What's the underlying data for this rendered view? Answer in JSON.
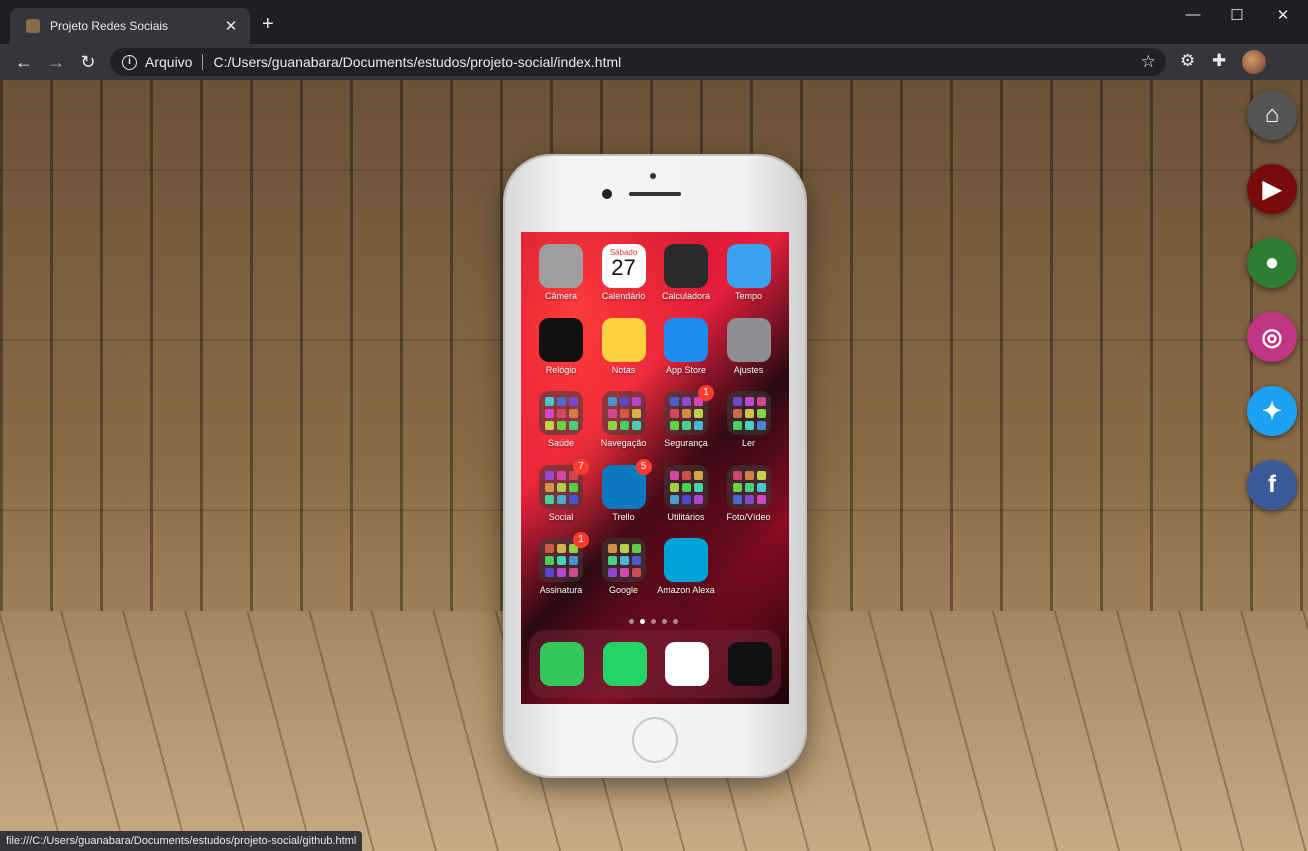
{
  "browser": {
    "tab_title": "Projeto Redes Sociais",
    "tab_close": "✕",
    "new_tab": "+",
    "scheme_label": "Arquivo",
    "url": "C:/Users/guanabara/Documents/estudos/projeto-social/index.html",
    "status_url": "file:///C:/Users/guanabara/Documents/estudos/projeto-social/github.html"
  },
  "phone": {
    "apps": [
      {
        "label": "Câmera",
        "icon": "camera-icon",
        "color": "#9e9e9e"
      },
      {
        "label": "Calendário",
        "icon": "calendar-icon",
        "color": "#ffffff",
        "day_name": "Sábado",
        "day_number": "27"
      },
      {
        "label": "Calculadora",
        "icon": "calculator-icon",
        "color": "#2b2b2b"
      },
      {
        "label": "Tempo",
        "icon": "weather-icon",
        "color": "#3aa0f0"
      },
      {
        "label": "Relógio",
        "icon": "clock-icon",
        "color": "#111111"
      },
      {
        "label": "Notas",
        "icon": "notes-icon",
        "color": "#ffd23f"
      },
      {
        "label": "App Store",
        "icon": "appstore-icon",
        "color": "#1e8cf0"
      },
      {
        "label": "Ajustes",
        "icon": "settings-icon",
        "color": "#8e8e93"
      },
      {
        "label": "Saúde",
        "icon": "folder-icon",
        "color": "#3c3c3c"
      },
      {
        "label": "Navegação",
        "icon": "folder-icon",
        "color": "#3c3c3c"
      },
      {
        "label": "Segurança",
        "icon": "folder-icon",
        "color": "#3c3c3c",
        "badge": "1"
      },
      {
        "label": "Ler",
        "icon": "folder-icon",
        "color": "#3c3c3c"
      },
      {
        "label": "Social",
        "icon": "folder-icon",
        "color": "#3c3c3c",
        "badge": "7"
      },
      {
        "label": "Trello",
        "icon": "trello-icon",
        "color": "#0a79bf",
        "badge": "5"
      },
      {
        "label": "Utilitários",
        "icon": "folder-icon",
        "color": "#3c3c3c"
      },
      {
        "label": "Foto/Vídeo",
        "icon": "folder-icon",
        "color": "#3c3c3c"
      },
      {
        "label": "Assinatura",
        "icon": "folder-icon",
        "color": "#3c3c3c",
        "badge": "1"
      },
      {
        "label": "Google",
        "icon": "folder-icon",
        "color": "#3c3c3c"
      },
      {
        "label": "Amazon Alexa",
        "icon": "alexa-icon",
        "color": "#00a3d8"
      }
    ],
    "dock": [
      {
        "icon": "phone-icon",
        "color": "#34c759"
      },
      {
        "icon": "whatsapp-icon",
        "color": "#25d366"
      },
      {
        "icon": "safari-icon",
        "color": "#ffffff"
      },
      {
        "icon": "spotify-icon",
        "color": "#111111"
      }
    ],
    "page_dots": 5,
    "active_dot": 1
  },
  "social_buttons": [
    {
      "name": "home",
      "color": "#555555"
    },
    {
      "name": "youtube",
      "color": "#7a0b0b"
    },
    {
      "name": "github",
      "color": "#2e7d32"
    },
    {
      "name": "instagram",
      "color": "#c13584"
    },
    {
      "name": "twitter",
      "color": "#1da1f2"
    },
    {
      "name": "facebook",
      "color": "#3b5998"
    }
  ]
}
